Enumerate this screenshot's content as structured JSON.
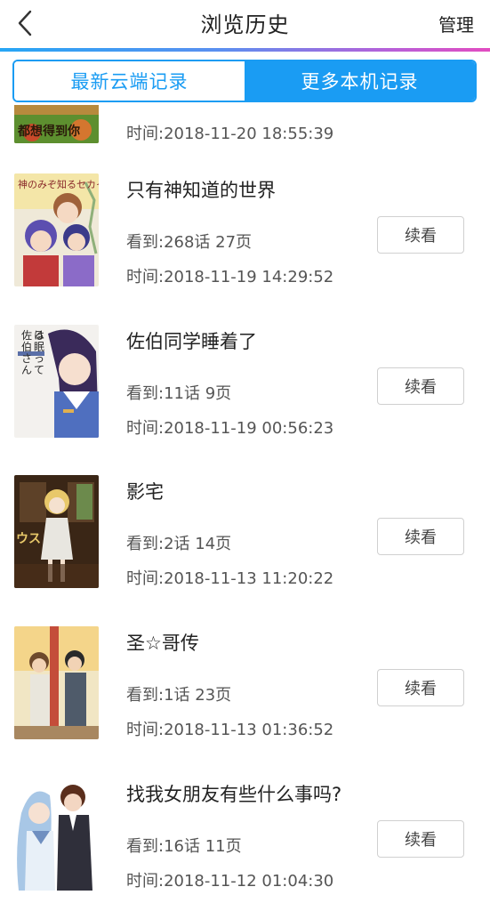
{
  "header": {
    "title": "浏览历史",
    "manage_label": "管理"
  },
  "tabs": [
    {
      "label": "最新云端记录",
      "active": false
    },
    {
      "label": "更多本机记录",
      "active": true
    }
  ],
  "history": [
    {
      "title": "",
      "progress": "",
      "time": "时间:2018-11-20 18:55:39",
      "read_label": ""
    },
    {
      "title": "只有神知道的世界",
      "progress": "看到:268话 27页",
      "time": "时间:2018-11-19 14:29:52",
      "read_label": "续看"
    },
    {
      "title": "佐伯同学睡着了",
      "progress": "看到:11话 9页",
      "time": "时间:2018-11-19 00:56:23",
      "read_label": "续看"
    },
    {
      "title": "影宅",
      "progress": "看到:2话 14页",
      "time": "时间:2018-11-13 11:20:22",
      "read_label": "续看"
    },
    {
      "title": "圣☆哥传",
      "progress": "看到:1话 23页",
      "time": "时间:2018-11-13 01:36:52",
      "read_label": "续看"
    },
    {
      "title": "找我女朋友有些什么事吗?",
      "progress": "看到:16话 11页",
      "time": "时间:2018-11-12 01:04:30",
      "read_label": "续看"
    }
  ],
  "cover_texts": {
    "item0": "都想得到你",
    "item1": "神のみぞ知るセカイ",
    "item2": "佐伯さんは眠ってる",
    "item3": "ウス"
  }
}
